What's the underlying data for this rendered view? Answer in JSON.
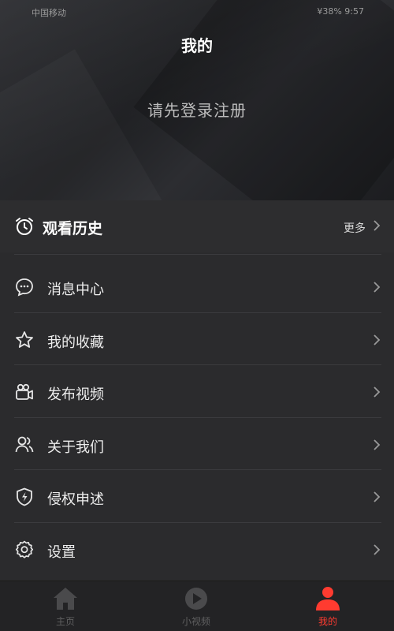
{
  "status_bar": {
    "left": "中国移动",
    "right": "¥38% 9:57"
  },
  "header": {
    "title": "我的",
    "login_prompt": "请先登录注册"
  },
  "history": {
    "label": "观看历史",
    "more": "更多",
    "icon": "alarm-clock-icon"
  },
  "menu": [
    {
      "label": "消息中心",
      "icon": "message-bubble-icon"
    },
    {
      "label": "我的收藏",
      "icon": "star-icon"
    },
    {
      "label": "发布视频",
      "icon": "video-camera-icon"
    },
    {
      "label": "关于我们",
      "icon": "users-icon"
    },
    {
      "label": "侵权申述",
      "icon": "shield-bolt-icon"
    },
    {
      "label": "设置",
      "icon": "gear-icon"
    }
  ],
  "tabbar": [
    {
      "label": "主页",
      "icon": "home-icon",
      "active": false
    },
    {
      "label": "小视频",
      "icon": "play-circle-icon",
      "active": false
    },
    {
      "label": "我的",
      "icon": "person-icon",
      "active": true
    }
  ],
  "colors": {
    "accent": "#ff3b30",
    "background": "#2b2b2d",
    "tab_inactive": "#5f5f60"
  }
}
